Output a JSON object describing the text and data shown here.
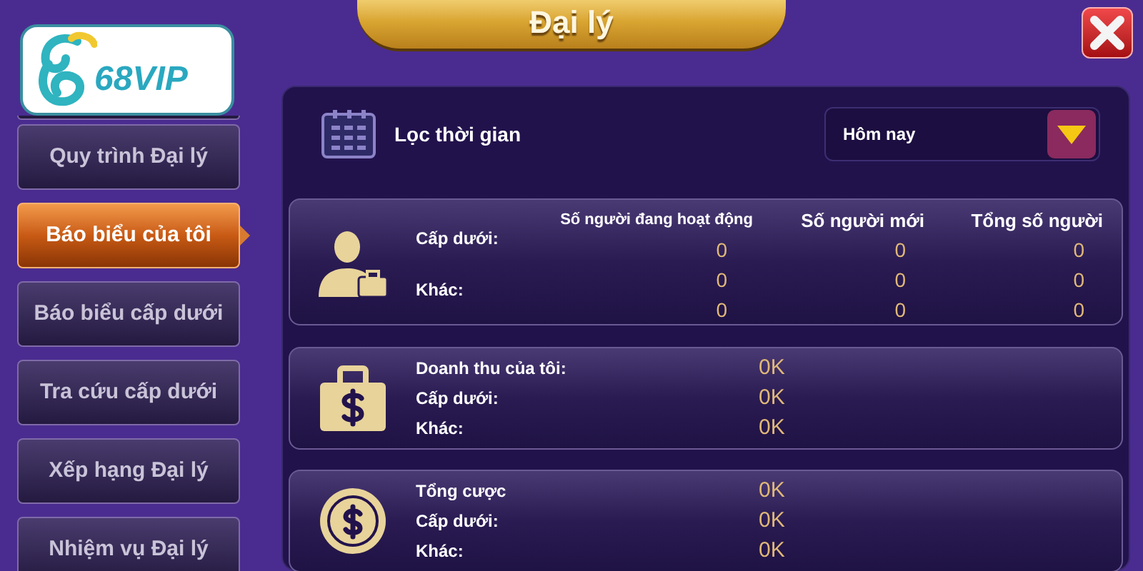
{
  "title": "Đại lý",
  "logo": {
    "text": "68VIP"
  },
  "sidebar": {
    "items": [
      {
        "label": "Quy trình Đại lý",
        "selected": false
      },
      {
        "label": "Báo biểu của tôi",
        "selected": true
      },
      {
        "label": "Báo biểu cấp dưới",
        "selected": false
      },
      {
        "label": "Tra cứu cấp dưới",
        "selected": false
      },
      {
        "label": "Xếp hạng Đại lý",
        "selected": false
      },
      {
        "label": "Nhiệm vụ Đại lý",
        "selected": false
      }
    ]
  },
  "filter": {
    "label": "Lọc thời gian",
    "dropdown": {
      "value": "Hôm nay"
    }
  },
  "members_card": {
    "columns": [
      "Số người đang hoạt động",
      "Số người mới",
      "Tổng số người"
    ],
    "row_labels": [
      "Cấp dưới:",
      "Khác:"
    ],
    "rows": [
      [
        "0",
        "0",
        "0"
      ],
      [
        "0",
        "0",
        "0"
      ],
      [
        "0",
        "0",
        "0"
      ]
    ]
  },
  "stat_cards": [
    {
      "kind": "bag",
      "rows": [
        {
          "label": "Doanh thu của tôi:",
          "value": "0K"
        },
        {
          "label": "Cấp dưới:",
          "value": "0K"
        },
        {
          "label": "Khác:",
          "value": "0K"
        }
      ]
    },
    {
      "kind": "coin",
      "rows": [
        {
          "label": "Tổng cược",
          "value": "0K"
        },
        {
          "label": "Cấp dưới:",
          "value": "0K"
        },
        {
          "label": "Khác:",
          "value": "0K"
        }
      ]
    }
  ]
}
